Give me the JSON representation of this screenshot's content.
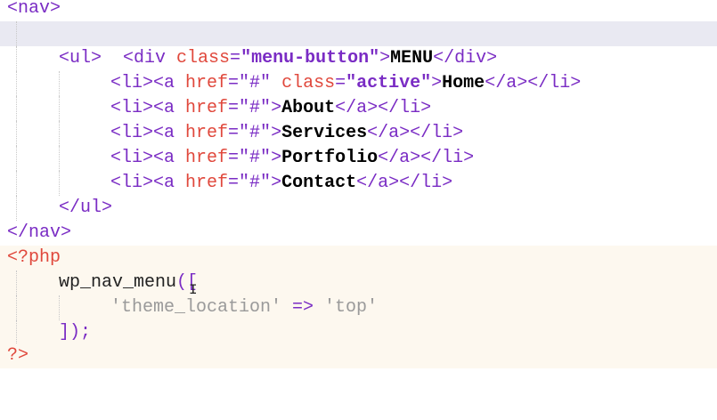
{
  "editor": {
    "lines": [
      {
        "id": "l1",
        "text": "<nav>"
      },
      {
        "id": "l2",
        "open": "<div ",
        "attr": "class",
        "eq": "=",
        "q1": "\"",
        "val": "menu-button",
        "q2": "\"",
        ">": ">",
        "content": "MENU",
        "close": "</div>"
      },
      {
        "id": "l3",
        "text": "<ul>"
      },
      {
        "id": "l4",
        "pre": "<li><a ",
        "attr1": "href",
        "eq1": "=",
        "val1": "\"#\"",
        "sp": " ",
        "attr2": "class",
        "eq2": "=",
        "q1": "\"",
        "val2": "active",
        "q2": "\"",
        "gt": ">",
        "content": "Home",
        "close": "</a></li>"
      },
      {
        "id": "l5",
        "pre": "<li><a ",
        "attr1": "href",
        "eq1": "=",
        "val1": "\"#\"",
        "gt": ">",
        "content": "About",
        "close": "</a></li>"
      },
      {
        "id": "l6",
        "pre": "<li><a ",
        "attr1": "href",
        "eq1": "=",
        "val1": "\"#\"",
        "gt": ">",
        "content": "Services",
        "close": "</a></li>"
      },
      {
        "id": "l7",
        "pre": "<li><a ",
        "attr1": "href",
        "eq1": "=",
        "val1": "\"#\"",
        "gt": ">",
        "content": "Portfolio",
        "close": "</a></li>"
      },
      {
        "id": "l8",
        "pre": "<li><a ",
        "attr1": "href",
        "eq1": "=",
        "val1": "\"#\"",
        "gt": ">",
        "content": "Contact",
        "close": "</a></li>"
      },
      {
        "id": "l9",
        "text": "</ul>"
      },
      {
        "id": "l10",
        "text": "</nav>"
      },
      {
        "id": "l11",
        "text": "<?php"
      },
      {
        "id": "l12",
        "fn": "wp_nav_menu",
        "punc": "(["
      },
      {
        "id": "l13",
        "key": "'theme_location'",
        "op": " => ",
        "val": "'top'"
      },
      {
        "id": "l14",
        "punc": "]);"
      },
      {
        "id": "l15",
        "text": "?>"
      }
    ]
  },
  "colors": {
    "tag": "#7a2cc4",
    "attr": "#e0483c",
    "php_bg": "#fdf8ef",
    "selection": "#e9e9f2"
  },
  "icons": [
    "text-caret-icon"
  ]
}
